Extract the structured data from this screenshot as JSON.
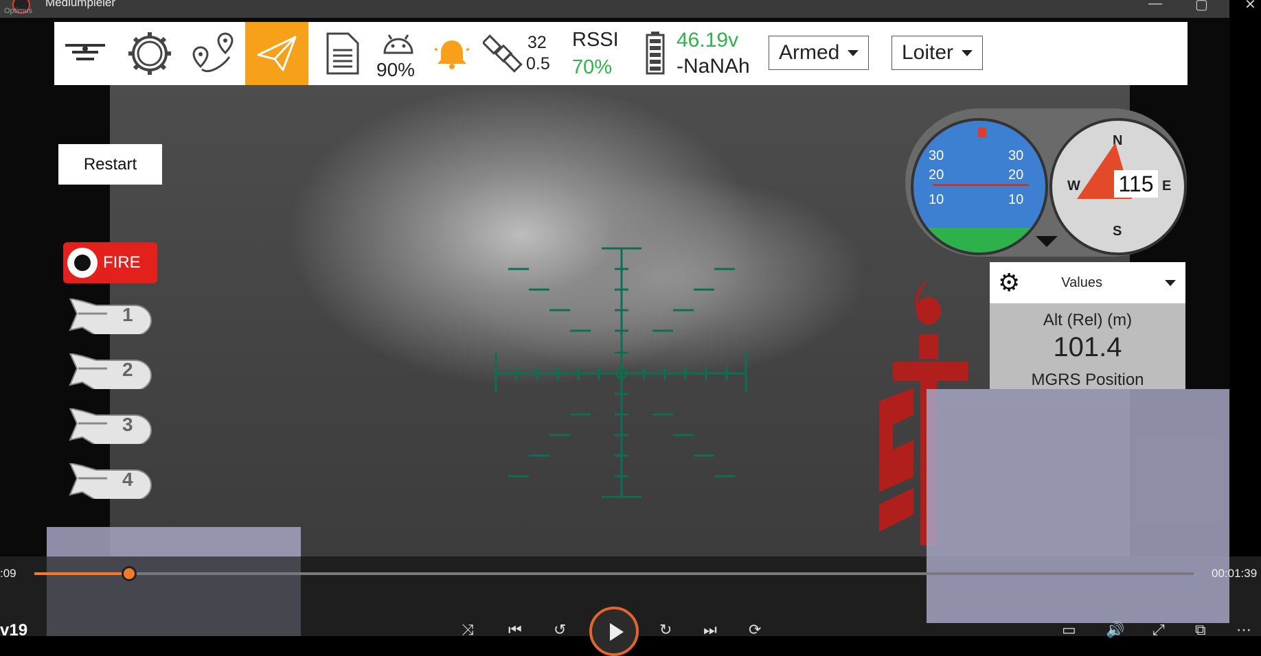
{
  "window": {
    "title": "Mediumpleier",
    "subtitle": "Optimus"
  },
  "toolbar": {
    "link_quality": "90%",
    "satellites": "32",
    "hdop": "0.5",
    "rssi_label": "RSSI",
    "rssi_value": "70%",
    "voltage": "46.19v",
    "battery_mah": "-NaNAh",
    "arm_state": "Armed",
    "flight_mode": "Loiter"
  },
  "controls": {
    "restart_label": "Restart",
    "fire_label": "FIRE",
    "bombs": [
      "1",
      "2",
      "3",
      "4"
    ]
  },
  "attitude": {
    "ticks_left": [
      "30",
      "20",
      "10"
    ],
    "ticks_right": [
      "30",
      "20",
      "10"
    ]
  },
  "compass": {
    "n": "N",
    "e": "E",
    "s": "S",
    "w": "W",
    "heading": "115"
  },
  "values_panel": {
    "header": "Values",
    "alt_label": "Alt (Rel) (m)",
    "alt_value": "101.4",
    "mgrs_label": "MGRS Position"
  },
  "player": {
    "current_time": ":09",
    "total_time": "00:01:39",
    "progress": 0.082,
    "episode": "v19"
  },
  "colors": {
    "accent": "#f7a11b",
    "fire": "#e3201b",
    "progress": "#f27a2a",
    "green": "#2db34a"
  }
}
